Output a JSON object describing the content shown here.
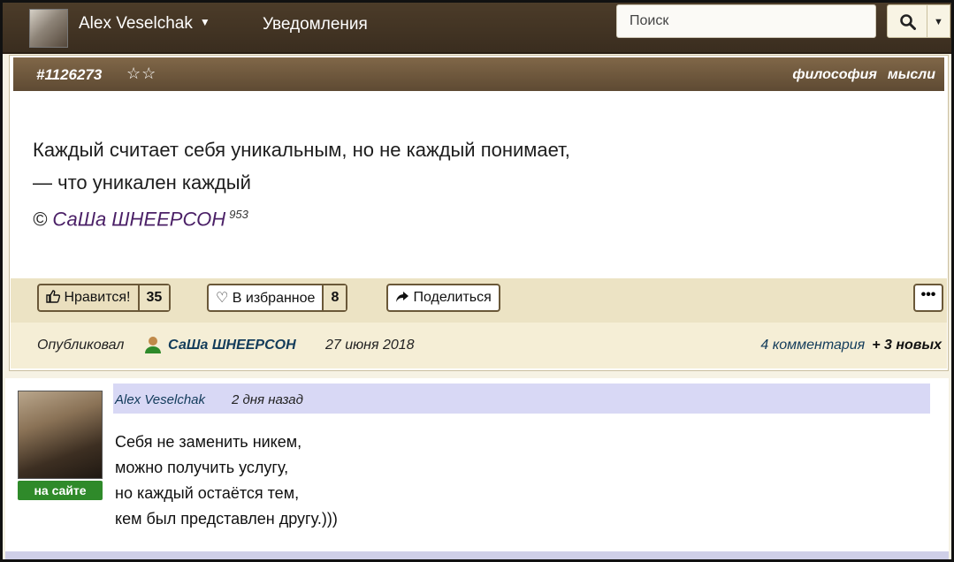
{
  "nav": {
    "user_name": "Alex Veselchak",
    "notifications": "Уведомления",
    "search_placeholder": "Поиск"
  },
  "quote": {
    "id": "#1126273",
    "stars": "☆☆",
    "tags": [
      "философия",
      "мысли"
    ],
    "line1": "Каждый считает себя уникальным, но не каждый понимает,",
    "line2": "— что уникален каждый",
    "copyright": "©",
    "author": "СаШа ШНЕЕРСОН",
    "author_count": "953"
  },
  "actions": {
    "like_label": "Нравится!",
    "like_count": "35",
    "fav_label": "В избранное",
    "fav_count": "8",
    "share_label": "Поделиться",
    "more_label": "•••"
  },
  "meta": {
    "published_label": "Опубликовал",
    "author": "СаШа ШНЕЕРСОН",
    "date": "27 июня 2018",
    "comments_link": "4 комментария",
    "new_count": "+ 3 новых"
  },
  "comment": {
    "author": "Alex Veselchak",
    "time": "2 дня назад",
    "status": "на сайте",
    "lines": [
      "Себя не заменить никем,",
      "можно получить услугу,",
      "но каждый остаётся тем,",
      "кем был представлен другу.)))"
    ]
  }
}
